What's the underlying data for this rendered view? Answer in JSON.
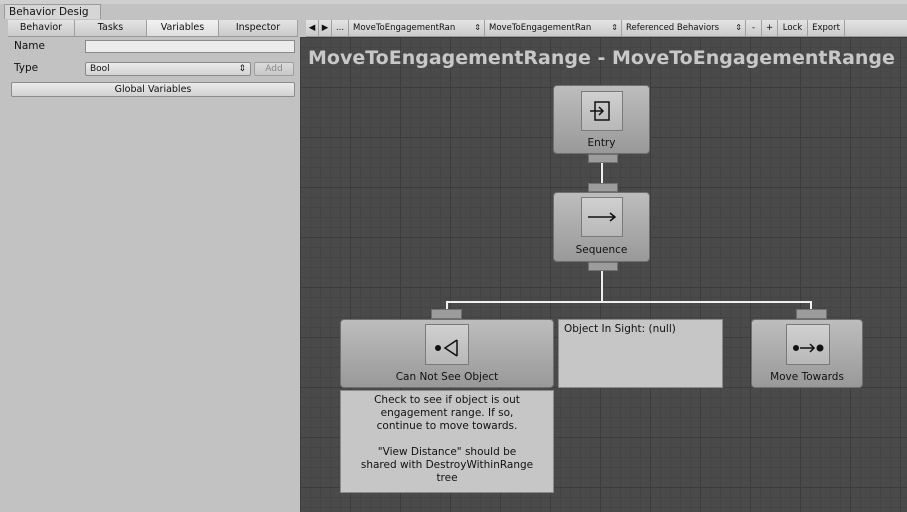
{
  "window": {
    "tab_title": "Behavior Desig"
  },
  "left_tabs": [
    {
      "label": "Behavior"
    },
    {
      "label": "Tasks"
    },
    {
      "label": "Variables"
    },
    {
      "label": "Inspector"
    }
  ],
  "variables": {
    "name_label": "Name",
    "name_value": "",
    "type_label": "Type",
    "type_value": "Bool",
    "add_label": "Add",
    "global_label": "Global Variables"
  },
  "toolbar": {
    "prev": "◀",
    "next": "▶",
    "more": "...",
    "behavior_select_1": "MoveToEngagementRan",
    "behavior_select_2": "MoveToEngagementRan",
    "referenced": "Referenced Behaviors",
    "minus": "-",
    "plus": "+",
    "lock": "Lock",
    "export": "Export"
  },
  "graph": {
    "title": "MoveToEngagementRange - MoveToEngagementRange",
    "nodes": {
      "entry": {
        "label": "Entry",
        "icon": "entry-icon"
      },
      "sequence": {
        "label": "Sequence",
        "icon": "arrow-right-icon"
      },
      "can_not_see": {
        "label": "Can Not See Object",
        "icon": "sight-icon"
      },
      "move_towards": {
        "label": "Move Towards",
        "icon": "move-towards-icon"
      }
    },
    "watch": {
      "text": "Object In Sight:  (null)"
    },
    "comment": {
      "line1": "Check to see if object is out",
      "line2": "engagement range. If so,",
      "line3": "continue to move towards.",
      "line4": "\"View Distance\" should be",
      "line5": "shared with DestroyWithinRange",
      "line6": "tree"
    }
  },
  "colors": {
    "graph_bg": "#4a4a4a",
    "panel_bg": "#c2c2c2",
    "wire": "#f0f0f0"
  }
}
